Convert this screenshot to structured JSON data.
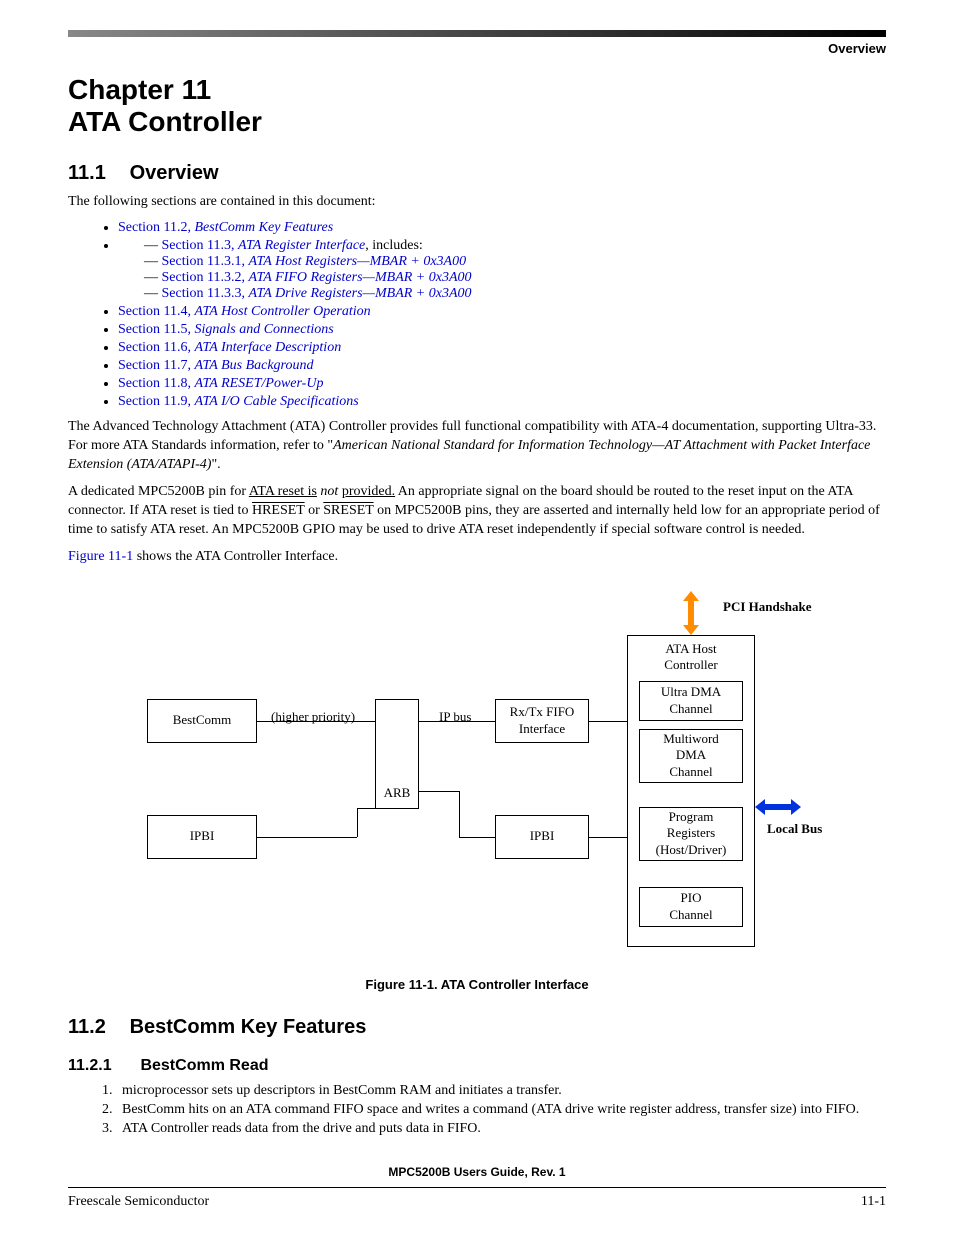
{
  "header": {
    "corner": "Overview"
  },
  "chapter": {
    "num": "Chapter 11",
    "title": "ATA Controller"
  },
  "sec_overview": {
    "num": "11.1",
    "title": "Overview",
    "intro": "The following sections are contained in this document:"
  },
  "toc": {
    "i0": {
      "sec": "Section 11.2, ",
      "t": "BestComm Key Features"
    },
    "i1": {
      "sec": "Section 11.3, ",
      "t": "ATA Register Interface",
      "suffix": ", includes:"
    },
    "i1a": {
      "sec": "Section 11.3.1, ",
      "t": "ATA Host Registers—MBAR + 0x3A00"
    },
    "i1b": {
      "sec": "Section 11.3.2, ",
      "t": "ATA FIFO Registers—MBAR + 0x3A00"
    },
    "i1c": {
      "sec": "Section 11.3.3, ",
      "t": "ATA Drive Registers—MBAR + 0x3A00"
    },
    "i2": {
      "sec": "Section 11.4, ",
      "t": "ATA Host Controller Operation"
    },
    "i3": {
      "sec": "Section 11.5, ",
      "t": "Signals and Connections"
    },
    "i4": {
      "sec": "Section 11.6, ",
      "t": "ATA Interface Description"
    },
    "i5": {
      "sec": "Section 11.7, ",
      "t": "ATA Bus Background"
    },
    "i6": {
      "sec": "Section 11.8, ",
      "t": "ATA RESET/Power-Up"
    },
    "i7": {
      "sec": "Section 11.9, ",
      "t": "ATA I/O Cable Specifications"
    }
  },
  "para1": {
    "a": "The Advanced Technology Attachment (ATA) Controller provides full functional compatibility with ATA-4 documentation, supporting Ultra-33. For more ATA Standards information, refer to \"",
    "b": "American National Standard for Information Technology—AT Attachment with Packet Interface Extension (ATA/ATAPI-4)",
    "c": "\"."
  },
  "para2": {
    "a": "A dedicated MPC5200B pin for ",
    "b": "ATA reset is",
    "c": " not ",
    "d": "provided.",
    "e": " An appropriate signal on the board should be routed to the reset input on the ATA connector. If ATA reset is tied to ",
    "f": "HRESET",
    "g": " or ",
    "h": "SRESET",
    "i": " on MPC5200B pins, they are asserted and internally held low for an appropriate period of time to satisfy ATA reset. An MPC5200B GPIO may be used to drive ATA reset independently if special software control is needed."
  },
  "para3": {
    "a": "Figure 11-1",
    "b": " shows the ATA Controller Interface."
  },
  "diagram": {
    "bestcomm": "BestComm",
    "ipbi_left": "IPBI",
    "higher": "(higher priority)",
    "arb": "ARB",
    "ipbus": "IP bus",
    "fifo": "Rx/Tx FIFO\nInterface",
    "ipbi_mid": "IPBI",
    "ata_host": "ATA Host\nController",
    "udma": "Ultra DMA\nChannel",
    "mwdma": "Multiword\nDMA\nChannel",
    "prog": "Program\nRegisters\n(Host/Driver)",
    "pio": "PIO\nChannel",
    "pci": "PCI Handshake",
    "localbus": "Local Bus"
  },
  "fig_caption": "Figure 11-1. ATA Controller Interface",
  "sec_features": {
    "num": "11.2",
    "title": "BestComm Key Features"
  },
  "sec_read": {
    "num": "11.2.1",
    "title": "BestComm Read",
    "items": [
      "microprocessor sets up descriptors in BestComm RAM and initiates a transfer.",
      "BestComm hits on an ATA command FIFO space and writes a command (ATA drive write register address, transfer size) into FIFO.",
      "ATA Controller reads data from the drive and puts data in FIFO."
    ]
  },
  "footer": {
    "center": "MPC5200B Users Guide, Rev. 1",
    "left": "Freescale Semiconductor",
    "right": "11-1"
  }
}
